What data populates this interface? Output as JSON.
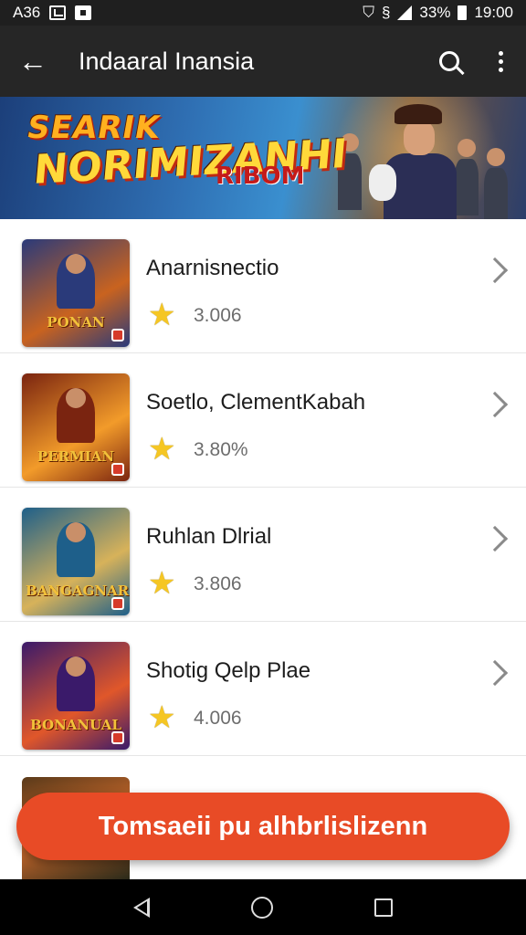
{
  "status_bar": {
    "left_text": "A36",
    "battery": "33%",
    "time": "19:00"
  },
  "app_bar": {
    "title": "Indaaral Inansia",
    "icons": [
      "back-arrow-icon",
      "search-icon",
      "more-vert-icon"
    ]
  },
  "banner": {
    "line1": "SEARIK",
    "line2": "NORIMIZANHI",
    "tag": "RIBOM"
  },
  "games": [
    {
      "title": "Anarnisnectio",
      "rating": "3.006",
      "thumb_text": "PONAN",
      "colors": [
        "#2a3a7a",
        "#c9631f"
      ]
    },
    {
      "title": "Soetlo, ClementKabah",
      "rating": "3.80%",
      "thumb_text": "PERMIAN",
      "colors": [
        "#7a2410",
        "#f29b2a"
      ]
    },
    {
      "title": "Ruhlan Dlrial",
      "rating": "3.806",
      "thumb_text": "BANGAGNAR",
      "colors": [
        "#1e5f8a",
        "#d7b25a"
      ]
    },
    {
      "title": "Shotig Qelp Plae",
      "rating": "4.006",
      "thumb_text": "BONANUAL",
      "colors": [
        "#3a1a6a",
        "#e0572a"
      ]
    }
  ],
  "cta": {
    "label": "Tomsaeii pu alhbrlislizenn",
    "color": "#e84b26"
  },
  "nav": {
    "icons": [
      "nav-back-icon",
      "nav-home-icon",
      "nav-recents-icon"
    ]
  }
}
